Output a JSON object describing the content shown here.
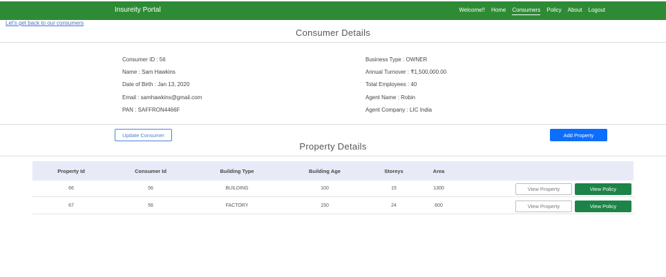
{
  "navbar": {
    "brand": "Insureity Portal",
    "links": [
      "Welcome!!",
      "Home",
      "Consumers",
      "Policy",
      "About",
      "Logout"
    ],
    "active": "Consumers"
  },
  "back_link": "Let's get back to our consumers",
  "consumer_section_title": "Consumer Details",
  "consumer": {
    "left": [
      "Consumer ID : 56",
      "Name : Sam Hawkins",
      "Date of Birth : Jan 13, 2020",
      "Email : samhawkins@gmail.com",
      "PAN : SAFFRON4466F"
    ],
    "right": [
      "Business Type : OWNER",
      "Annual Turnover : ₹1,500,000.00",
      "Total Employees : 40",
      "Agent Name : Robin",
      "Agent Company : LIC India"
    ]
  },
  "buttons": {
    "update_consumer": "Update Consumer",
    "add_property": "Add Property"
  },
  "property_section_title": "Property Details",
  "table": {
    "headers": [
      "Property Id",
      "Consumer Id",
      "Building Type",
      "Building Age",
      "Storeys",
      "Area"
    ],
    "rows": [
      [
        "66",
        "56",
        "BUILDING",
        "100",
        "15",
        "1300"
      ],
      [
        "67",
        "56",
        "FACTORY",
        "150",
        "24",
        "600"
      ]
    ],
    "view_property_label": "View Property",
    "view_policy_label": "View Policy"
  },
  "colors": {
    "navbar": "#2e8b35",
    "primary": "#0d6efd",
    "policy_button": "#1d8348",
    "table_header": "#e8ebf7"
  }
}
